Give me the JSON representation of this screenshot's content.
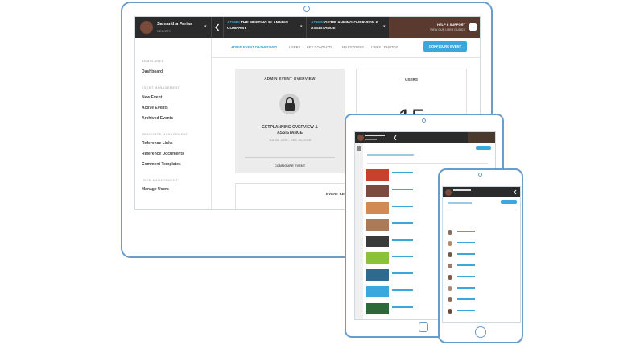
{
  "user": {
    "name": "Samantha Farias",
    "role": "CEO/CFO"
  },
  "header": {
    "company_prefix": "ADMIN",
    "company_name": "THE MEETING PLANNING COMPANY",
    "event_prefix": "ADMIN",
    "event_name": "GETPLANNING OVERVIEW & ASSISTANCE",
    "help_label": "HELP & SUPPORT",
    "guide_label": "VIEW OUR USER GUIDES"
  },
  "sidebar": {
    "sections": [
      {
        "heading": "ADMIN AREA",
        "items": [
          "Dashboard"
        ]
      },
      {
        "heading": "EVENT MANAGEMENT",
        "items": [
          "New Event",
          "Active Events",
          "Archived Events"
        ]
      },
      {
        "heading": "RESOURCE MANAGEMENT",
        "items": [
          "Reference Links",
          "Reference Documents",
          "Comment Templates"
        ]
      },
      {
        "heading": "USER MANAGEMENT",
        "items": [
          "Manage Users"
        ]
      }
    ]
  },
  "tabs": [
    "ADMIN EVENT DASHBOARD",
    "USERS",
    "KEY CONTACTS",
    "MILESTONES",
    "LINKS",
    "PHOTOS"
  ],
  "configure_button": "CONFIGURE EVENT",
  "overview": {
    "title": "ADMIN EVENT OVERVIEW",
    "event_name": "GETPLANNING OVERVIEW & ASSISTANCE",
    "dates": "JUL 26, 2016 - DEC 20, 2016",
    "configure_link": "CONFIGURE EVENT"
  },
  "users_card": {
    "title": "USERS",
    "count": "15"
  },
  "event_key_label": "EVENT KE",
  "colors": {
    "accent": "#3aa8dc",
    "device_outline": "#6a9cc9",
    "header_dark": "#2b2b2b"
  },
  "icons": [
    "chevron-left-icon",
    "lock-icon",
    "home-button-icon",
    "camera-icon"
  ]
}
